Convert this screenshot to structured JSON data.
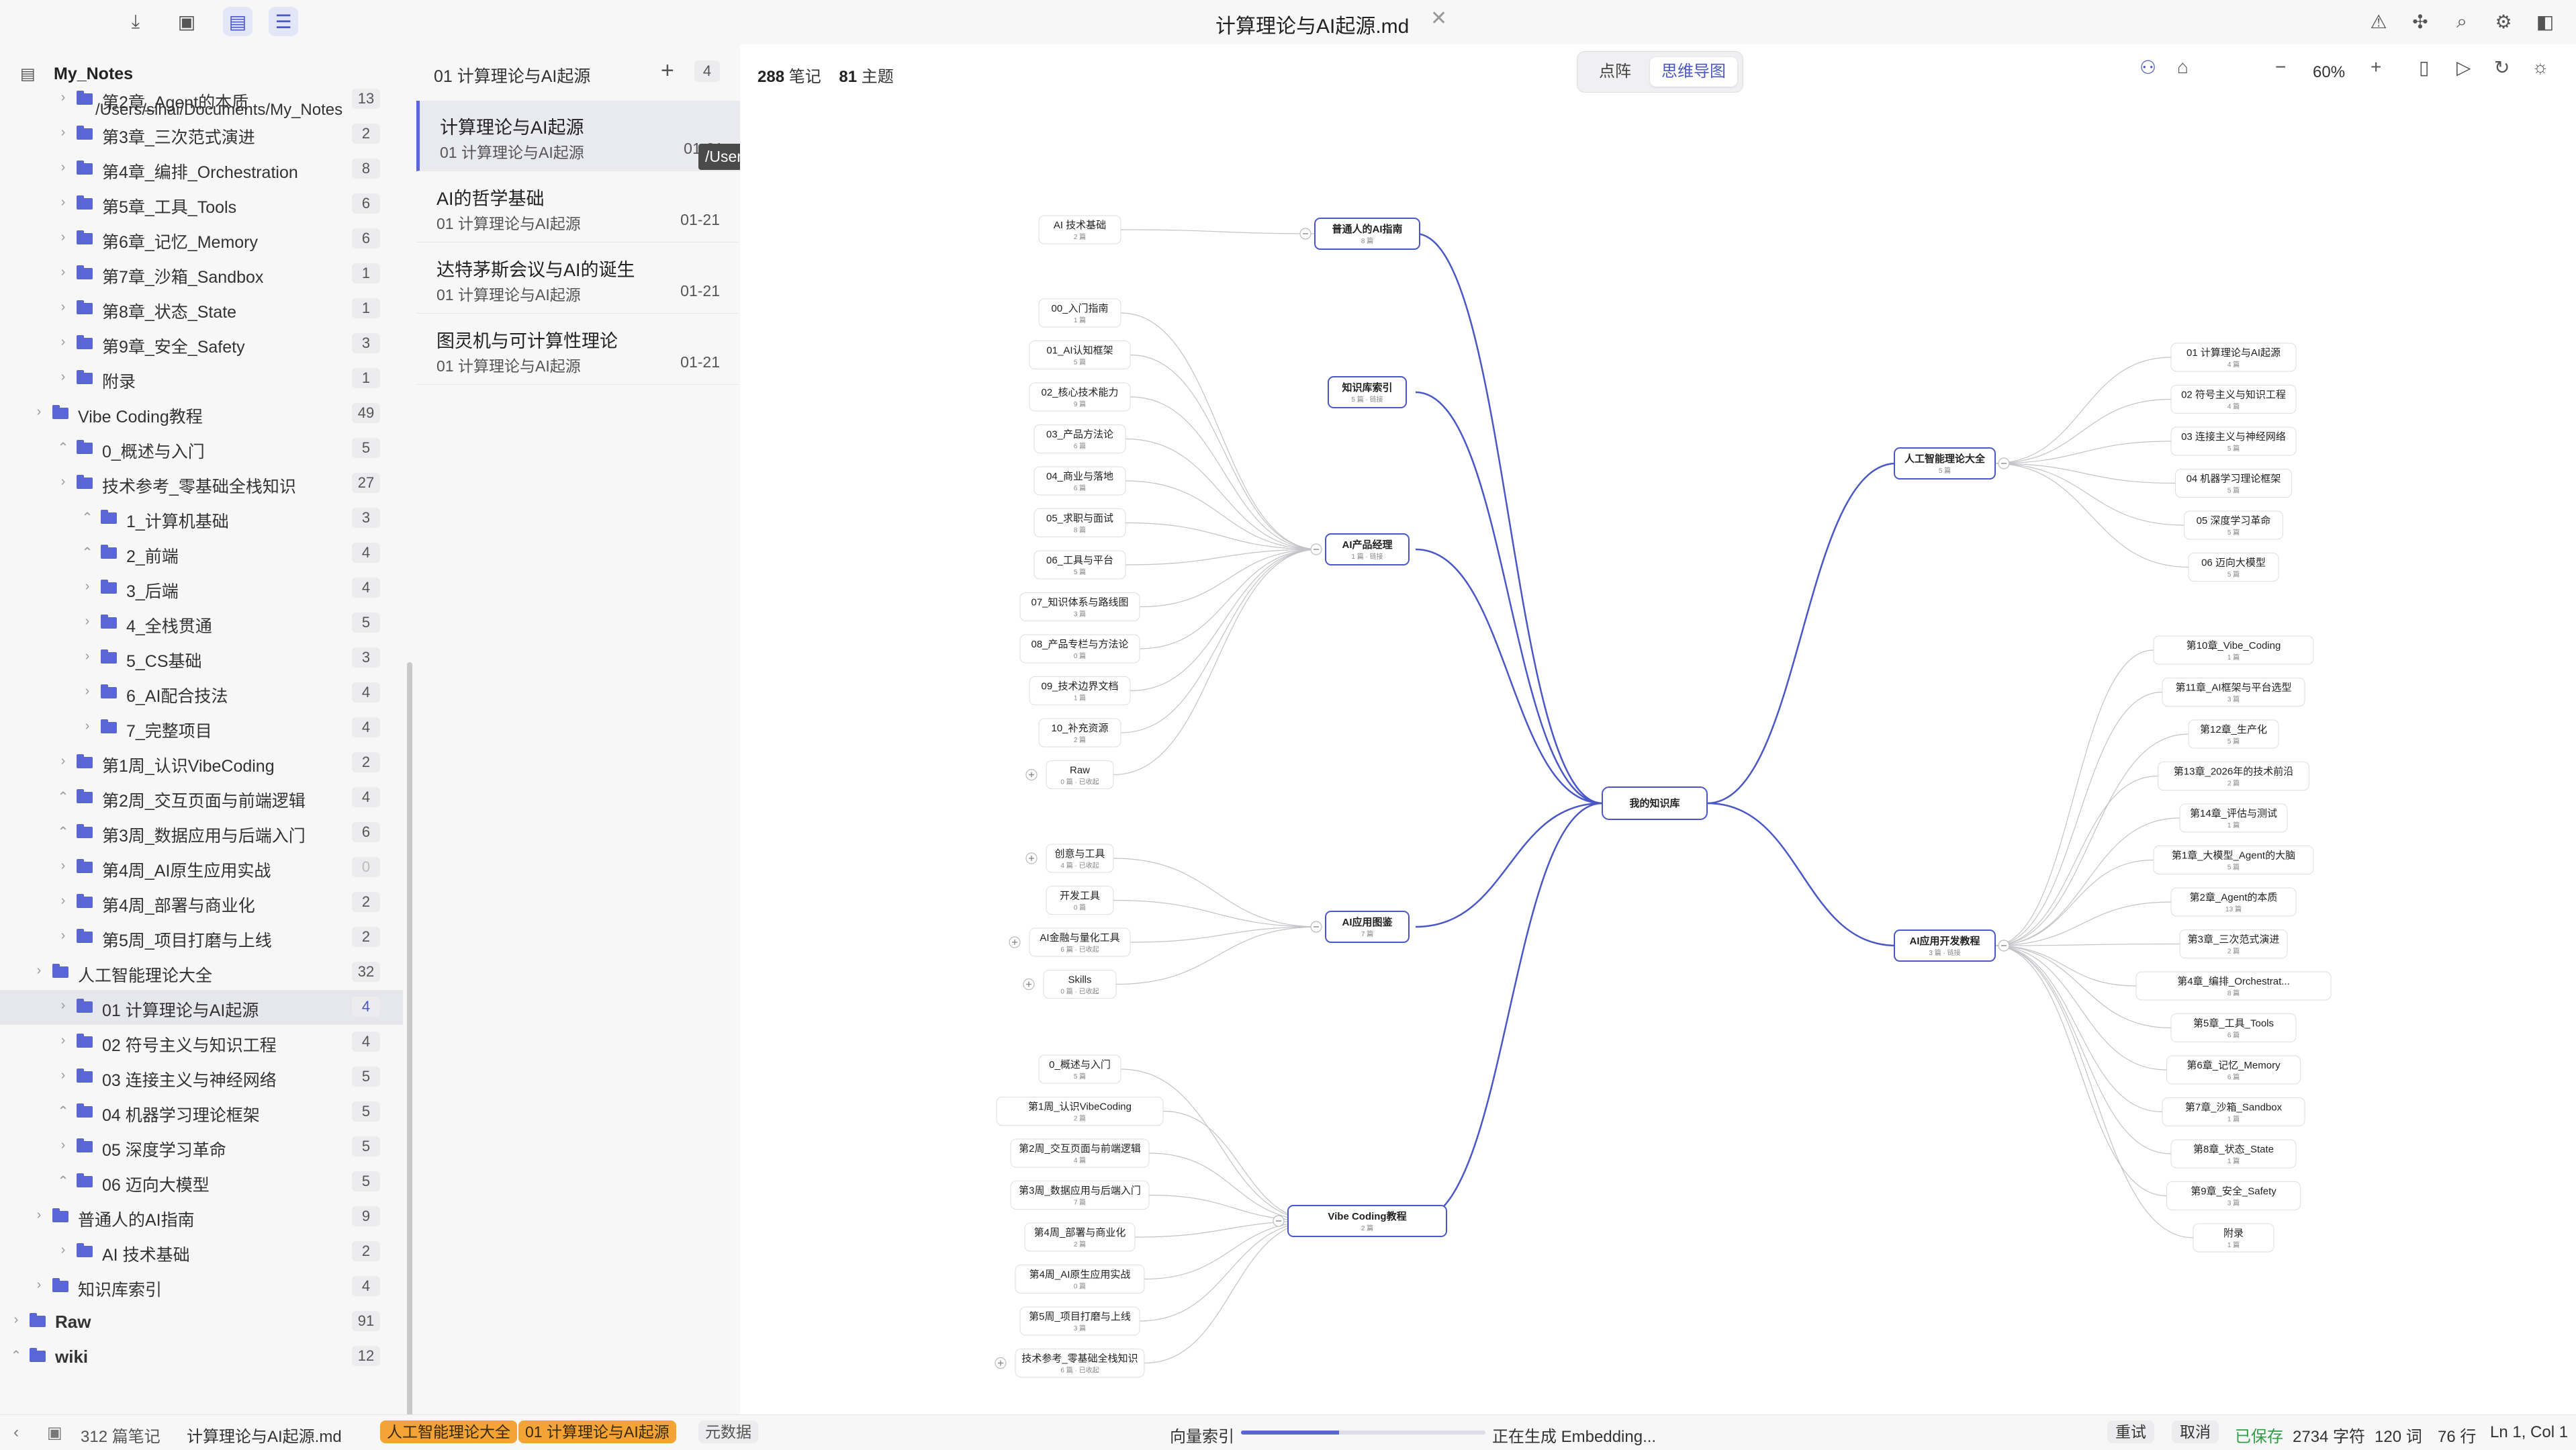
{
  "window": {
    "title": "计算理论与AI起源.md"
  },
  "sidebar": {
    "root": "My_Notes",
    "path": "/Users/sihai/Documents/My_Notes",
    "items": [
      {
        "label": "第2章_Agent的本质",
        "count": "13",
        "level": 2,
        "open": false
      },
      {
        "label": "第3章_三次范式演进",
        "count": "2",
        "level": 2,
        "open": false
      },
      {
        "label": "第4章_编排_Orchestration",
        "count": "8",
        "level": 2,
        "open": false
      },
      {
        "label": "第5章_工具_Tools",
        "count": "6",
        "level": 2,
        "open": false
      },
      {
        "label": "第6章_记忆_Memory",
        "count": "6",
        "level": 2,
        "open": false
      },
      {
        "label": "第7章_沙箱_Sandbox",
        "count": "1",
        "level": 2,
        "open": false
      },
      {
        "label": "第8章_状态_State",
        "count": "1",
        "level": 2,
        "open": false
      },
      {
        "label": "第9章_安全_Safety",
        "count": "3",
        "level": 2,
        "open": false
      },
      {
        "label": "附录",
        "count": "1",
        "level": 2,
        "open": false
      },
      {
        "label": "Vibe Coding教程",
        "count": "49",
        "level": 1,
        "open": false
      },
      {
        "label": "0_概述与入门",
        "count": "5",
        "level": 2,
        "open": true
      },
      {
        "label": "技术参考_零基础全栈知识",
        "count": "27",
        "level": 2,
        "open": false
      },
      {
        "label": "1_计算机基础",
        "count": "3",
        "level": 3,
        "open": true
      },
      {
        "label": "2_前端",
        "count": "4",
        "level": 3,
        "open": true
      },
      {
        "label": "3_后端",
        "count": "4",
        "level": 3,
        "open": false
      },
      {
        "label": "4_全栈贯通",
        "count": "5",
        "level": 3,
        "open": false
      },
      {
        "label": "5_CS基础",
        "count": "3",
        "level": 3,
        "open": false
      },
      {
        "label": "6_AI配合技法",
        "count": "4",
        "level": 3,
        "open": false
      },
      {
        "label": "7_完整项目",
        "count": "4",
        "level": 3,
        "open": false
      },
      {
        "label": "第1周_认识VibeCoding",
        "count": "2",
        "level": 2,
        "open": false
      },
      {
        "label": "第2周_交互页面与前端逻辑",
        "count": "4",
        "level": 2,
        "open": true
      },
      {
        "label": "第3周_数据应用与后端入门",
        "count": "6",
        "level": 2,
        "open": true
      },
      {
        "label": "第4周_AI原生应用实战",
        "count": "0",
        "level": 2,
        "open": false
      },
      {
        "label": "第4周_部署与商业化",
        "count": "2",
        "level": 2,
        "open": false
      },
      {
        "label": "第5周_项目打磨与上线",
        "count": "2",
        "level": 2,
        "open": false
      },
      {
        "label": "人工智能理论大全",
        "count": "32",
        "level": 1,
        "open": false
      },
      {
        "label": "01 计算理论与AI起源",
        "count": "4",
        "level": 2,
        "open": false,
        "selected": true
      },
      {
        "label": "02 符号主义与知识工程",
        "count": "4",
        "level": 2,
        "open": false
      },
      {
        "label": "03 连接主义与神经网络",
        "count": "5",
        "level": 2,
        "open": false
      },
      {
        "label": "04 机器学习理论框架",
        "count": "5",
        "level": 2,
        "open": true
      },
      {
        "label": "05 深度学习革命",
        "count": "5",
        "level": 2,
        "open": false
      },
      {
        "label": "06 迈向大模型",
        "count": "5",
        "level": 2,
        "open": true
      },
      {
        "label": "普通人的AI指南",
        "count": "9",
        "level": 1,
        "open": false
      },
      {
        "label": "AI 技术基础",
        "count": "2",
        "level": 2,
        "open": false
      },
      {
        "label": "知识库索引",
        "count": "4",
        "level": 1,
        "open": false
      },
      {
        "label": "Raw",
        "count": "91",
        "level": 0,
        "open": false
      },
      {
        "label": "wiki",
        "count": "12",
        "level": 0,
        "open": true
      }
    ]
  },
  "notelist": {
    "header": "01 计算理论与AI起源",
    "count": "4",
    "tooltip": "/Users/sihai/Documents/My_Notes",
    "notes": [
      {
        "title": "计算理论与AI起源",
        "folder": "01 计算理论与AI起源",
        "date": "01-21"
      },
      {
        "title": "AI的哲学基础",
        "folder": "01 计算理论与AI起源",
        "date": "01-21"
      },
      {
        "title": "达特茅斯会议与AI的诞生",
        "folder": "01 计算理论与AI起源",
        "date": "01-21"
      },
      {
        "title": "图灵机与可计算性理论",
        "folder": "01 计算理论与AI起源",
        "date": "01-21"
      }
    ]
  },
  "main": {
    "stats": {
      "notes_num": "288",
      "notes_label": "笔记",
      "topics_num": "81",
      "topics_label": "主题"
    },
    "view_tabs": [
      "点阵",
      "思维导图"
    ],
    "active_view": "思维导图",
    "zoom": "60%",
    "mindmap": {
      "root": "我的知识库",
      "left": [
        {
          "id": "ordinary",
          "title": "普通人的AI指南",
          "sub": "8 篇",
          "children": [
            {
              "t": "AI 技术基础",
              "s": "2 篇"
            }
          ]
        },
        {
          "id": "index",
          "title": "知识库索引",
          "sub": "5 篇 · 链接",
          "children": []
        },
        {
          "id": "pm",
          "title": "AI产品经理",
          "sub": "1 篇 · 链接",
          "children": [
            {
              "t": "00_入门指南",
              "s": "1 篇"
            },
            {
              "t": "01_AI认知框架",
              "s": "5 篇"
            },
            {
              "t": "02_核心技术能力",
              "s": "9 篇"
            },
            {
              "t": "03_产品方法论",
              "s": "6 篇"
            },
            {
              "t": "04_商业与落地",
              "s": "6 篇"
            },
            {
              "t": "05_求职与面试",
              "s": "8 篇"
            },
            {
              "t": "06_工具与平台",
              "s": "5 篇"
            },
            {
              "t": "07_知识体系与路线图",
              "s": "3 篇"
            },
            {
              "t": "08_产品专栏与方法论",
              "s": "0 篇"
            },
            {
              "t": "09_技术边界文档",
              "s": "1 篇"
            },
            {
              "t": "10_补充资源",
              "s": "2 篇"
            },
            {
              "t": "Raw",
              "s": "0 篇 · 已收起",
              "plus": true
            }
          ]
        },
        {
          "id": "apps",
          "title": "AI应用图鉴",
          "sub": "7 篇",
          "children": [
            {
              "t": "创意与工具",
              "s": "4 篇 · 已收起",
              "plus": true
            },
            {
              "t": "开发工具",
              "s": "0 篇"
            },
            {
              "t": "AI金融与量化工具",
              "s": "6 篇 · 已收起",
              "plus": true
            },
            {
              "t": "Skills",
              "s": "0 篇 · 已收起",
              "plus": true
            }
          ]
        },
        {
          "id": "vibe",
          "title": "Vibe Coding教程",
          "sub": "2 篇",
          "children": [
            {
              "t": "0_概述与入门",
              "s": "5 篇"
            },
            {
              "t": "第1周_认识VibeCoding",
              "s": "2 篇"
            },
            {
              "t": "第2周_交互页面与前端逻辑",
              "s": "4 篇"
            },
            {
              "t": "第3周_数据应用与后端入门",
              "s": "7 篇"
            },
            {
              "t": "第4周_部署与商业化",
              "s": "2 篇"
            },
            {
              "t": "第4周_AI原生应用实战",
              "s": "0 篇"
            },
            {
              "t": "第5周_项目打磨与上线",
              "s": "3 篇"
            },
            {
              "t": "技术参考_零基础全栈知识",
              "s": "6 篇 · 已收起",
              "plus": true
            }
          ]
        }
      ],
      "right": [
        {
          "id": "theory",
          "title": "人工智能理论大全",
          "sub": "5 篇",
          "children": [
            {
              "t": "01 计算理论与AI起源",
              "s": "4 篇"
            },
            {
              "t": "02 符号主义与知识工程",
              "s": "4 篇"
            },
            {
              "t": "03 连接主义与神经网络",
              "s": "5 篇"
            },
            {
              "t": "04 机器学习理论框架",
              "s": "5 篇"
            },
            {
              "t": "05 深度学习革命",
              "s": "5 篇"
            },
            {
              "t": "06 迈向大模型",
              "s": "5 篇"
            }
          ]
        },
        {
          "id": "dev",
          "title": "AI应用开发教程",
          "sub": "3 篇 · 链接",
          "children": [
            {
              "t": "第10章_Vibe_Coding",
              "s": "1 篇"
            },
            {
              "t": "第11章_AI框架与平台选型",
              "s": "3 篇"
            },
            {
              "t": "第12章_生产化",
              "s": "5 篇"
            },
            {
              "t": "第13章_2026年的技术前沿",
              "s": "2 篇"
            },
            {
              "t": "第14章_评估与测试",
              "s": "1 篇"
            },
            {
              "t": "第1章_大模型_Agent的大脑",
              "s": "5 篇"
            },
            {
              "t": "第2章_Agent的本质",
              "s": "13 篇"
            },
            {
              "t": "第3章_三次范式演进",
              "s": "2 篇"
            },
            {
              "t": "第4章_编排_Orchestrat...",
              "s": "8 篇"
            },
            {
              "t": "第5章_工具_Tools",
              "s": "6 篇"
            },
            {
              "t": "第6章_记忆_Memory",
              "s": "6 篇"
            },
            {
              "t": "第7章_沙箱_Sandbox",
              "s": "1 篇"
            },
            {
              "t": "第8章_状态_State",
              "s": "1 篇"
            },
            {
              "t": "第9章_安全_Safety",
              "s": "3 篇"
            },
            {
              "t": "附录",
              "s": "1 篇"
            }
          ]
        }
      ]
    }
  },
  "statusbar": {
    "notes_count": "312 篇笔记",
    "filename": "计算理论与AI起源.md",
    "tags": [
      "人工智能理论大全",
      "01 计算理论与AI起源"
    ],
    "meta_btn": "元数据",
    "index_label": "向量索引",
    "progress": 0.4,
    "progress_text": "正在生成 Embedding...",
    "retry": "重试",
    "cancel": "取消",
    "saved": "已保存",
    "chars": "2734 字符",
    "words": "120 词",
    "lines": "76 行",
    "cursor": "Ln 1, Col 1"
  },
  "colors": {
    "accent": "#5b66d6",
    "edge_main": "#4a57c8",
    "edge_child": "#c4c4c8",
    "saved": "#2f9e44",
    "tag": "#f4a436"
  }
}
